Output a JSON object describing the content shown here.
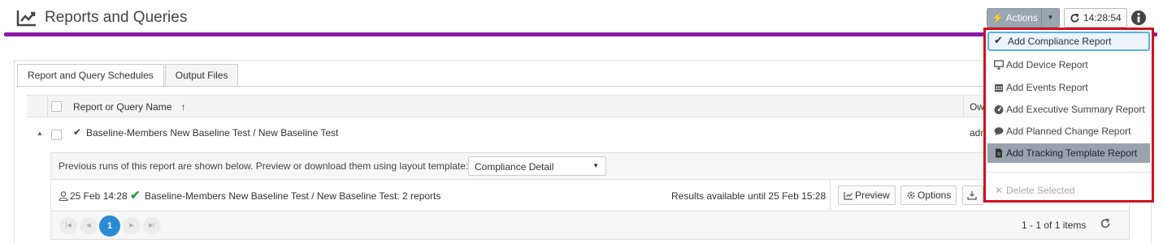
{
  "header": {
    "title": "Reports and Queries"
  },
  "toolbar": {
    "actions_label": "Actions",
    "time": "14:28:54"
  },
  "actions_menu": {
    "items": [
      {
        "label": "Add Compliance Report",
        "icon": "check-icon"
      },
      {
        "label": "Add Device Report",
        "icon": "monitor-icon"
      },
      {
        "label": "Add Events Report",
        "icon": "calendar-icon"
      },
      {
        "label": "Add Executive Summary Report",
        "icon": "dashboard-icon"
      },
      {
        "label": "Add Planned Change Report",
        "icon": "speech-bubble-icon"
      },
      {
        "label": "Add Tracking Template Report",
        "icon": "document-icon"
      }
    ],
    "delete_label": "Delete Selected"
  },
  "tabs": [
    {
      "label": "Report and Query Schedules",
      "active": true
    },
    {
      "label": "Output Files",
      "active": false
    }
  ],
  "grid": {
    "columns": {
      "name": "Report or Query Name",
      "sort_indicator": "↑",
      "owner": "Ow"
    },
    "row": {
      "name": "Baseline-Members New Baseline Test / New Baseline Test",
      "owner": "adm"
    }
  },
  "detail": {
    "intro": "Previous runs of this report are shown below. Preview or download them using layout template:",
    "template_selected": "Compliance Detail",
    "run": {
      "date": "25 Feb 14:28",
      "name": "Baseline-Members New Baseline Test / New Baseline Test: 2 reports",
      "availability": "Results available until 25 Feb 15:28",
      "preview_label": "Preview",
      "options_label": "Options"
    },
    "pager": {
      "current_page": "1",
      "count_text": "1 - 1 of 1 items"
    }
  },
  "colors": {
    "accent_bar": "#8b1aa8",
    "highlight_border": "#d1121b",
    "page_active": "#2a8ad4",
    "success": "#2e9a3b"
  }
}
